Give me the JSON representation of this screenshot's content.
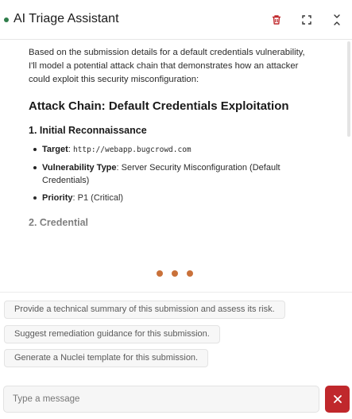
{
  "header": {
    "title": "AI Triage Assistant",
    "status_color": "#2f7d4a",
    "icons": [
      "trash-icon",
      "expand-icon",
      "collapse-icon"
    ]
  },
  "message": {
    "intro": "Based on the submission details for a default credentials vulnerability, I'll model a potential attack chain that demonstrates how an attacker could exploit this security misconfiguration:",
    "heading": "Attack Chain: Default Credentials Exploitation",
    "section1": "1. Initial Reconnaissance",
    "bullets": [
      {
        "label": "Target",
        "sep": ": ",
        "value": "http://webapp.bugcrowd.com"
      },
      {
        "label": "Vulnerability Type",
        "sep": ": ",
        "value": "Server Security Misconfiguration (Default Credentials)"
      },
      {
        "label": "Priority",
        "sep": ": ",
        "value": "P1 (Critical)"
      }
    ],
    "section2": "2. Credential"
  },
  "suggestions": [
    "Provide a technical summary of this submission and assess its risk.",
    "Suggest remediation guidance for this submission.",
    "Generate a Nuclei template for this submission."
  ],
  "composer": {
    "placeholder": "Type a message",
    "stop_icon": "close-icon",
    "stop_color": "#c0282c"
  },
  "colors": {
    "typing_dots": "#c9713a"
  }
}
